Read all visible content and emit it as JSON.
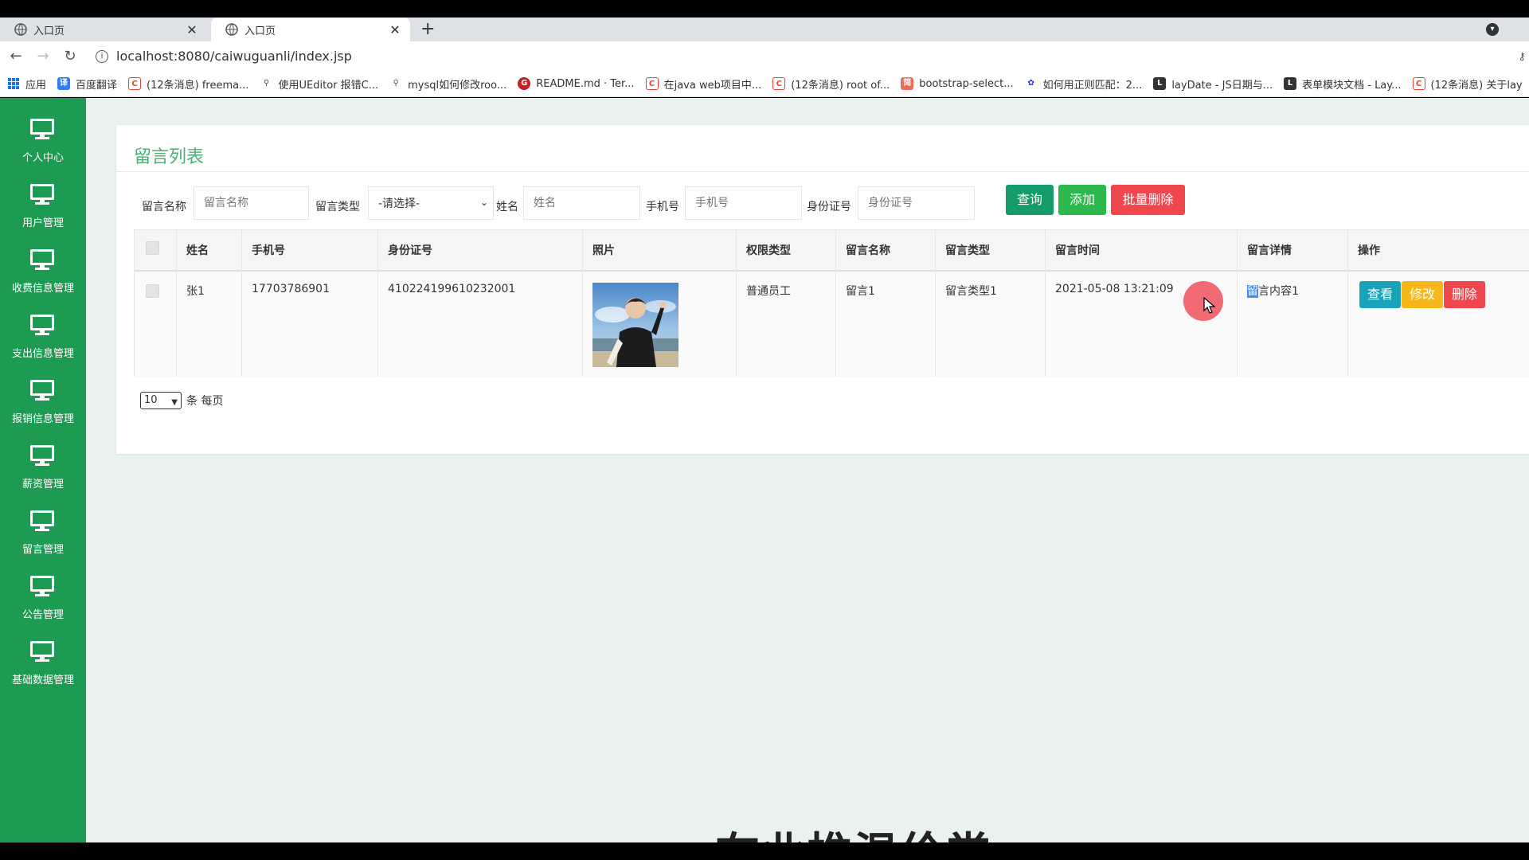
{
  "browser": {
    "tabs": [
      {
        "title": "入口页",
        "active": false
      },
      {
        "title": "入口页",
        "active": true
      }
    ],
    "new_tab": "+",
    "url": "localhost:8080/caiwuguanli/index.jsp",
    "bookmarks": [
      {
        "label": "应用",
        "icon": "apps-grid-icon"
      },
      {
        "label": "百度翻译",
        "icon": "baidu-translate-icon",
        "color": "#2f7ff2"
      },
      {
        "label": "(12条消息) freema...",
        "icon": "csdn-icon",
        "color": "#e8463a"
      },
      {
        "label": "使用UEditor 报错C...",
        "icon": "ue-icon",
        "color": "#555555"
      },
      {
        "label": "mysql如何修改roo...",
        "icon": "mysql-icon",
        "color": "#555555"
      },
      {
        "label": "README.md · Ter...",
        "icon": "gitee-icon",
        "color": "#c71d23"
      },
      {
        "label": "在java web项目中...",
        "icon": "csdn-icon",
        "color": "#e8463a"
      },
      {
        "label": "(12条消息) root of...",
        "icon": "csdn-icon",
        "color": "#e8463a"
      },
      {
        "label": "bootstrap-select...",
        "icon": "jianshu-icon",
        "color": "#ea6f5a"
      },
      {
        "label": "如何用正则匹配：2...",
        "icon": "baidu-icon",
        "color": "#2932e1"
      },
      {
        "label": "layDate - JS日期与...",
        "icon": "layui-icon",
        "color": "#333333"
      },
      {
        "label": "表单模块文档 - Lay...",
        "icon": "layui-icon",
        "color": "#333333"
      },
      {
        "label": "(12条消息) 关于lay",
        "icon": "csdn-icon",
        "color": "#e8463a"
      }
    ]
  },
  "sidebar": {
    "items": [
      {
        "label": "个人中心"
      },
      {
        "label": "用户管理"
      },
      {
        "label": "收费信息管理"
      },
      {
        "label": "支出信息管理"
      },
      {
        "label": "报销信息管理"
      },
      {
        "label": "薪资管理"
      },
      {
        "label": "留言管理"
      },
      {
        "label": "公告管理"
      },
      {
        "label": "基础数据管理"
      }
    ]
  },
  "page": {
    "title": "留言列表",
    "filters": {
      "name_label": "留言名称",
      "name_placeholder": "留言名称",
      "type_label": "留言类型",
      "type_selected": "-请选择-",
      "person_label": "姓名",
      "person_placeholder": "姓名",
      "phone_label": "手机号",
      "phone_placeholder": "手机号",
      "id_label": "身份证号",
      "id_placeholder": "身份证号"
    },
    "buttons": {
      "query": "查询",
      "add": "添加",
      "batch_delete": "批量删除"
    },
    "table": {
      "headers": [
        "姓名",
        "手机号",
        "身份证号",
        "照片",
        "权限类型",
        "留言名称",
        "留言类型",
        "留言时间",
        "留言详情",
        "操作"
      ],
      "rows": [
        {
          "name": "张1",
          "phone": "17703786901",
          "id_card": "410224199610232001",
          "role": "普通员工",
          "msg_name": "留言1",
          "msg_type": "留言类型1",
          "msg_time": "2021-05-08 13:21:09",
          "msg_detail_hl": "留",
          "msg_detail_rest": "言内容1",
          "actions": {
            "view": "查看",
            "edit": "修改",
            "delete": "删除"
          }
        }
      ]
    },
    "pager": {
      "page_size": "10",
      "suffix": "条 每页"
    }
  },
  "colors": {
    "sidebar": "#1e9b53",
    "title": "#4caf78",
    "query_btn": "#169b6b",
    "add_btn": "#2db84d",
    "danger_btn": "#f0474f",
    "view_btn": "#1aa3b8",
    "edit_btn": "#f5b71a"
  },
  "overlay_text": "在业推温伦堂"
}
